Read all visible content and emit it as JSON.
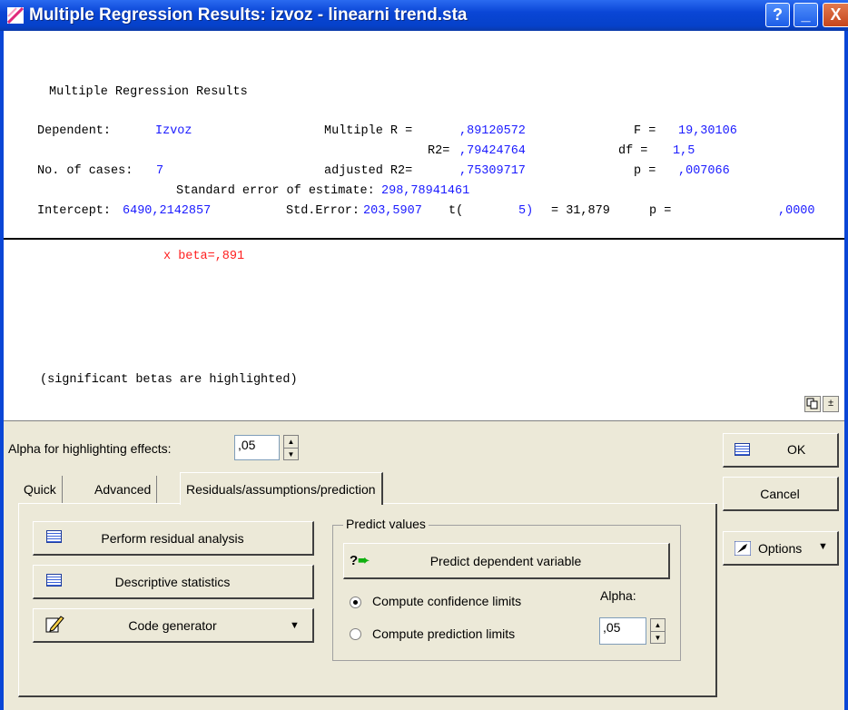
{
  "window": {
    "title": "Multiple Regression Results: izvoz - linearni trend.sta",
    "help_label": "?",
    "minimize_label": "_",
    "close_label": "X"
  },
  "output": {
    "heading": "Multiple Regression Results",
    "dependent_label": "Dependent:",
    "dependent_value": "Izvoz",
    "multiple_r_label": "Multiple R =",
    "multiple_r_value": ",89120572",
    "f_label": "F =",
    "f_value": "19,30106",
    "r2_label": "R2=",
    "r2_value": ",79424764",
    "df_label": "df =",
    "df_value": "1,5",
    "cases_label": "No. of cases:",
    "cases_value": "7",
    "adj_r2_label": "adjusted R2=",
    "adj_r2_value": ",75309717",
    "p_label": "p =",
    "p_value": ",007066",
    "std_err_estimate_label": "Standard error of estimate:",
    "std_err_estimate_value": "298,78941461",
    "intercept_label": "Intercept:",
    "intercept_value": "6490,2142857",
    "std_error_label": "Std.Error:",
    "std_error_value": "203,5907",
    "t_label": "t(",
    "t_df": "5)",
    "t_eq": "= 31,879",
    "p2_label": "p =",
    "p2_value": ",0000",
    "beta_text": "x beta=,891",
    "note": "(significant betas are highlighted)"
  },
  "dialog": {
    "alpha_label": "Alpha for highlighting effects:",
    "alpha_value": ",05",
    "ok_label": "OK",
    "cancel_label": "Cancel",
    "options_label": "Options",
    "tabs": [
      "Quick",
      "Advanced",
      "Residuals/assumptions/prediction"
    ],
    "buttons": {
      "residual": "Perform residual analysis",
      "descriptive": "Descriptive statistics",
      "codegen": "Code generator"
    },
    "predict": {
      "group_title": "Predict values",
      "predict_button": "Predict dependent variable",
      "confidence_label": "Compute confidence limits",
      "prediction_label": "Compute prediction limits",
      "alpha_label": "Alpha:",
      "alpha_value": ",05",
      "selected": "confidence"
    }
  }
}
